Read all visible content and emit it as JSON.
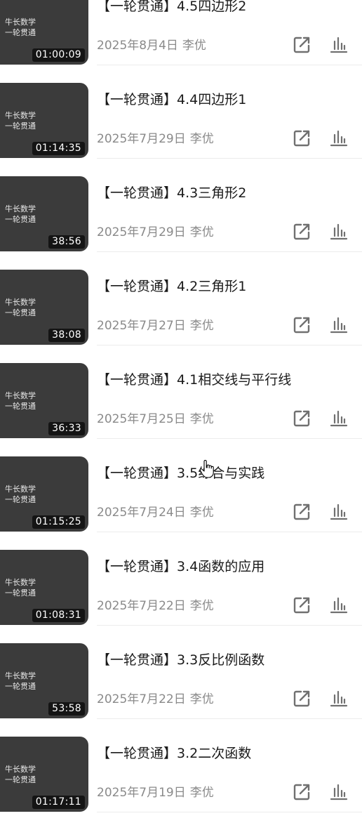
{
  "thumbnail_caption": "牛长数学\n一轮贯通",
  "videos": [
    {
      "title": "【一轮贯通】4.5四边形2",
      "date": "2025年8月4日",
      "author": "李优",
      "duration": "01:00:09"
    },
    {
      "title": "【一轮贯通】4.4四边形1",
      "date": "2025年7月29日",
      "author": "李优",
      "duration": "01:14:35"
    },
    {
      "title": "【一轮贯通】4.3三角形2",
      "date": "2025年7月29日",
      "author": "李优",
      "duration": "38:56"
    },
    {
      "title": "【一轮贯通】4.2三角形1",
      "date": "2025年7月27日",
      "author": "李优",
      "duration": "38:08"
    },
    {
      "title": "【一轮贯通】4.1相交线与平行线",
      "date": "2025年7月25日",
      "author": "李优",
      "duration": "36:33"
    },
    {
      "title": "【一轮贯通】3.5综合与实践",
      "date": "2025年7月24日",
      "author": "李优",
      "duration": "01:15:25"
    },
    {
      "title": "【一轮贯通】3.4函数的应用",
      "date": "2025年7月22日",
      "author": "李优",
      "duration": "01:08:31"
    },
    {
      "title": "【一轮贯通】3.3反比例函数",
      "date": "2025年7月22日",
      "author": "李优",
      "duration": "53:58"
    },
    {
      "title": "【一轮贯通】3.2二次函数",
      "date": "2025年7月19日",
      "author": "李优",
      "duration": "01:17:11"
    }
  ],
  "icons": {
    "share": "share-external-icon",
    "stats": "bar-chart-icon",
    "cursor": "hand-pointer-cursor"
  },
  "colors": {
    "thumbnail_bg": "#3b3b3b",
    "title_text": "#1a1a1a",
    "meta_text": "#8a8a8a",
    "icon_stroke": "#707070"
  }
}
